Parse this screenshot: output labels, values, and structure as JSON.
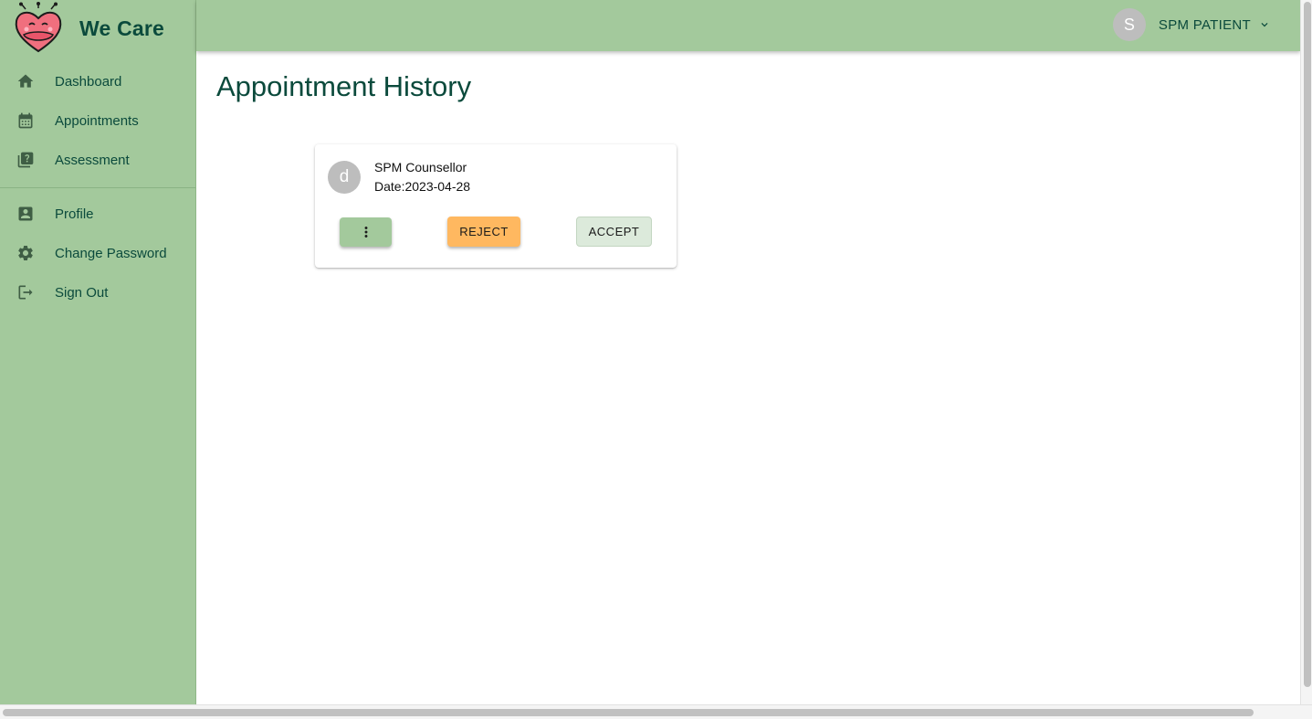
{
  "brand": {
    "name": "We Care"
  },
  "sidebar": {
    "items": [
      {
        "label": "Dashboard",
        "icon": "home-icon"
      },
      {
        "label": "Appointments",
        "icon": "calendar-icon"
      },
      {
        "label": "Assessment",
        "icon": "quiz-icon"
      },
      {
        "label": "Profile",
        "icon": "account-box-icon"
      },
      {
        "label": "Change Password",
        "icon": "gear-icon"
      },
      {
        "label": "Sign Out",
        "icon": "logout-icon"
      }
    ]
  },
  "header": {
    "user_initial": "S",
    "user_name": "SPM PATIENT"
  },
  "main": {
    "title": "Appointment History",
    "appointments": [
      {
        "avatar_initial": "d",
        "name": "SPM Counsellor",
        "date": "Date:2023-04-28",
        "reject_label": "REJECT",
        "accept_label": "ACCEPT"
      }
    ]
  },
  "colors": {
    "sidebar_bg": "#a3c99c",
    "text_dark_green": "#0b4a3c",
    "reject_orange": "#ffb860",
    "accept_bg": "#dceadb"
  }
}
